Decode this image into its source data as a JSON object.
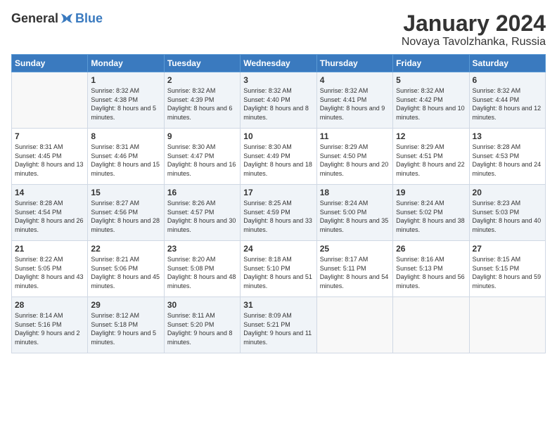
{
  "header": {
    "logo_general": "General",
    "logo_blue": "Blue",
    "month": "January 2024",
    "location": "Novaya Tavolzhanka, Russia"
  },
  "days_of_week": [
    "Sunday",
    "Monday",
    "Tuesday",
    "Wednesday",
    "Thursday",
    "Friday",
    "Saturday"
  ],
  "weeks": [
    [
      {
        "day": "",
        "sunrise": "",
        "sunset": "",
        "daylight": ""
      },
      {
        "day": "1",
        "sunrise": "Sunrise: 8:32 AM",
        "sunset": "Sunset: 4:38 PM",
        "daylight": "Daylight: 8 hours and 5 minutes."
      },
      {
        "day": "2",
        "sunrise": "Sunrise: 8:32 AM",
        "sunset": "Sunset: 4:39 PM",
        "daylight": "Daylight: 8 hours and 6 minutes."
      },
      {
        "day": "3",
        "sunrise": "Sunrise: 8:32 AM",
        "sunset": "Sunset: 4:40 PM",
        "daylight": "Daylight: 8 hours and 8 minutes."
      },
      {
        "day": "4",
        "sunrise": "Sunrise: 8:32 AM",
        "sunset": "Sunset: 4:41 PM",
        "daylight": "Daylight: 8 hours and 9 minutes."
      },
      {
        "day": "5",
        "sunrise": "Sunrise: 8:32 AM",
        "sunset": "Sunset: 4:42 PM",
        "daylight": "Daylight: 8 hours and 10 minutes."
      },
      {
        "day": "6",
        "sunrise": "Sunrise: 8:32 AM",
        "sunset": "Sunset: 4:44 PM",
        "daylight": "Daylight: 8 hours and 12 minutes."
      }
    ],
    [
      {
        "day": "7",
        "sunrise": "Sunrise: 8:31 AM",
        "sunset": "Sunset: 4:45 PM",
        "daylight": "Daylight: 8 hours and 13 minutes."
      },
      {
        "day": "8",
        "sunrise": "Sunrise: 8:31 AM",
        "sunset": "Sunset: 4:46 PM",
        "daylight": "Daylight: 8 hours and 15 minutes."
      },
      {
        "day": "9",
        "sunrise": "Sunrise: 8:30 AM",
        "sunset": "Sunset: 4:47 PM",
        "daylight": "Daylight: 8 hours and 16 minutes."
      },
      {
        "day": "10",
        "sunrise": "Sunrise: 8:30 AM",
        "sunset": "Sunset: 4:49 PM",
        "daylight": "Daylight: 8 hours and 18 minutes."
      },
      {
        "day": "11",
        "sunrise": "Sunrise: 8:29 AM",
        "sunset": "Sunset: 4:50 PM",
        "daylight": "Daylight: 8 hours and 20 minutes."
      },
      {
        "day": "12",
        "sunrise": "Sunrise: 8:29 AM",
        "sunset": "Sunset: 4:51 PM",
        "daylight": "Daylight: 8 hours and 22 minutes."
      },
      {
        "day": "13",
        "sunrise": "Sunrise: 8:28 AM",
        "sunset": "Sunset: 4:53 PM",
        "daylight": "Daylight: 8 hours and 24 minutes."
      }
    ],
    [
      {
        "day": "14",
        "sunrise": "Sunrise: 8:28 AM",
        "sunset": "Sunset: 4:54 PM",
        "daylight": "Daylight: 8 hours and 26 minutes."
      },
      {
        "day": "15",
        "sunrise": "Sunrise: 8:27 AM",
        "sunset": "Sunset: 4:56 PM",
        "daylight": "Daylight: 8 hours and 28 minutes."
      },
      {
        "day": "16",
        "sunrise": "Sunrise: 8:26 AM",
        "sunset": "Sunset: 4:57 PM",
        "daylight": "Daylight: 8 hours and 30 minutes."
      },
      {
        "day": "17",
        "sunrise": "Sunrise: 8:25 AM",
        "sunset": "Sunset: 4:59 PM",
        "daylight": "Daylight: 8 hours and 33 minutes."
      },
      {
        "day": "18",
        "sunrise": "Sunrise: 8:24 AM",
        "sunset": "Sunset: 5:00 PM",
        "daylight": "Daylight: 8 hours and 35 minutes."
      },
      {
        "day": "19",
        "sunrise": "Sunrise: 8:24 AM",
        "sunset": "Sunset: 5:02 PM",
        "daylight": "Daylight: 8 hours and 38 minutes."
      },
      {
        "day": "20",
        "sunrise": "Sunrise: 8:23 AM",
        "sunset": "Sunset: 5:03 PM",
        "daylight": "Daylight: 8 hours and 40 minutes."
      }
    ],
    [
      {
        "day": "21",
        "sunrise": "Sunrise: 8:22 AM",
        "sunset": "Sunset: 5:05 PM",
        "daylight": "Daylight: 8 hours and 43 minutes."
      },
      {
        "day": "22",
        "sunrise": "Sunrise: 8:21 AM",
        "sunset": "Sunset: 5:06 PM",
        "daylight": "Daylight: 8 hours and 45 minutes."
      },
      {
        "day": "23",
        "sunrise": "Sunrise: 8:20 AM",
        "sunset": "Sunset: 5:08 PM",
        "daylight": "Daylight: 8 hours and 48 minutes."
      },
      {
        "day": "24",
        "sunrise": "Sunrise: 8:18 AM",
        "sunset": "Sunset: 5:10 PM",
        "daylight": "Daylight: 8 hours and 51 minutes."
      },
      {
        "day": "25",
        "sunrise": "Sunrise: 8:17 AM",
        "sunset": "Sunset: 5:11 PM",
        "daylight": "Daylight: 8 hours and 54 minutes."
      },
      {
        "day": "26",
        "sunrise": "Sunrise: 8:16 AM",
        "sunset": "Sunset: 5:13 PM",
        "daylight": "Daylight: 8 hours and 56 minutes."
      },
      {
        "day": "27",
        "sunrise": "Sunrise: 8:15 AM",
        "sunset": "Sunset: 5:15 PM",
        "daylight": "Daylight: 8 hours and 59 minutes."
      }
    ],
    [
      {
        "day": "28",
        "sunrise": "Sunrise: 8:14 AM",
        "sunset": "Sunset: 5:16 PM",
        "daylight": "Daylight: 9 hours and 2 minutes."
      },
      {
        "day": "29",
        "sunrise": "Sunrise: 8:12 AM",
        "sunset": "Sunset: 5:18 PM",
        "daylight": "Daylight: 9 hours and 5 minutes."
      },
      {
        "day": "30",
        "sunrise": "Sunrise: 8:11 AM",
        "sunset": "Sunset: 5:20 PM",
        "daylight": "Daylight: 9 hours and 8 minutes."
      },
      {
        "day": "31",
        "sunrise": "Sunrise: 8:09 AM",
        "sunset": "Sunset: 5:21 PM",
        "daylight": "Daylight: 9 hours and 11 minutes."
      },
      {
        "day": "",
        "sunrise": "",
        "sunset": "",
        "daylight": ""
      },
      {
        "day": "",
        "sunrise": "",
        "sunset": "",
        "daylight": ""
      },
      {
        "day": "",
        "sunrise": "",
        "sunset": "",
        "daylight": ""
      }
    ]
  ]
}
